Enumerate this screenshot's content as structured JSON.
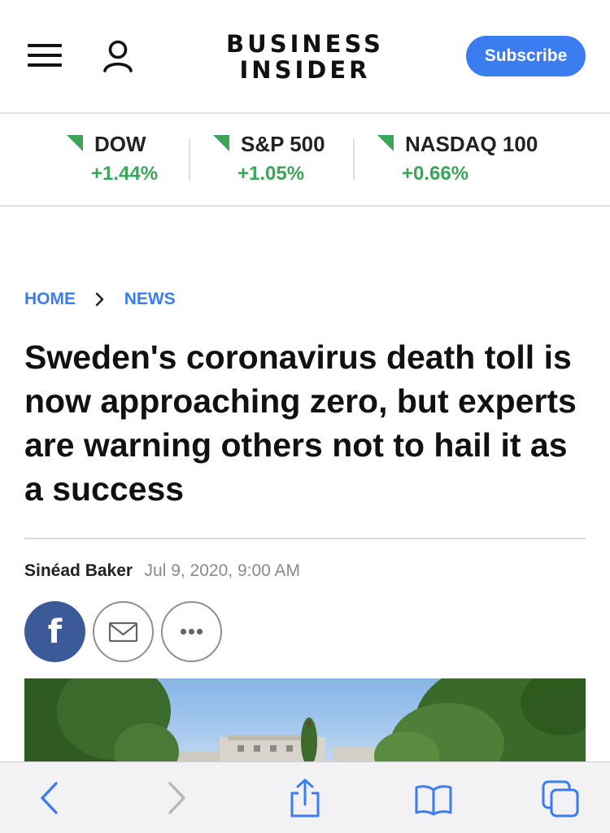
{
  "header": {
    "logo_line1": "BUSINESS",
    "logo_line2": "INSIDER",
    "subscribe_label": "Subscribe",
    "accent_color": "#3b7df0"
  },
  "markets": [
    {
      "name": "DOW",
      "change": "+1.44%"
    },
    {
      "name": "S&P 500",
      "change": "+1.05%"
    },
    {
      "name": "NASDAQ 100",
      "change": "+0.66%"
    }
  ],
  "market_up_color": "#3aa657",
  "breadcrumb": {
    "home": "HOME",
    "section": "NEWS"
  },
  "article": {
    "headline": "Sweden's coronavirus death toll is now approaching zero, but experts are warning others not to hail it as a success",
    "author": "Sinéad Baker",
    "date": "Jul 9, 2020, 9:00 AM"
  },
  "share": {
    "facebook_letter": "f",
    "facebook_color": "#3d5a98"
  },
  "icons": {
    "menu": "hamburger-menu-icon",
    "account": "user-account-icon",
    "breadcrumb_separator": "chevron-right-icon",
    "email": "envelope-icon",
    "more": "ellipsis-icon",
    "browser_back": "chevron-left-icon",
    "browser_forward": "chevron-right-icon",
    "browser_share": "share-icon",
    "browser_bookmarks": "book-icon",
    "browser_tabs": "tabs-icon"
  }
}
